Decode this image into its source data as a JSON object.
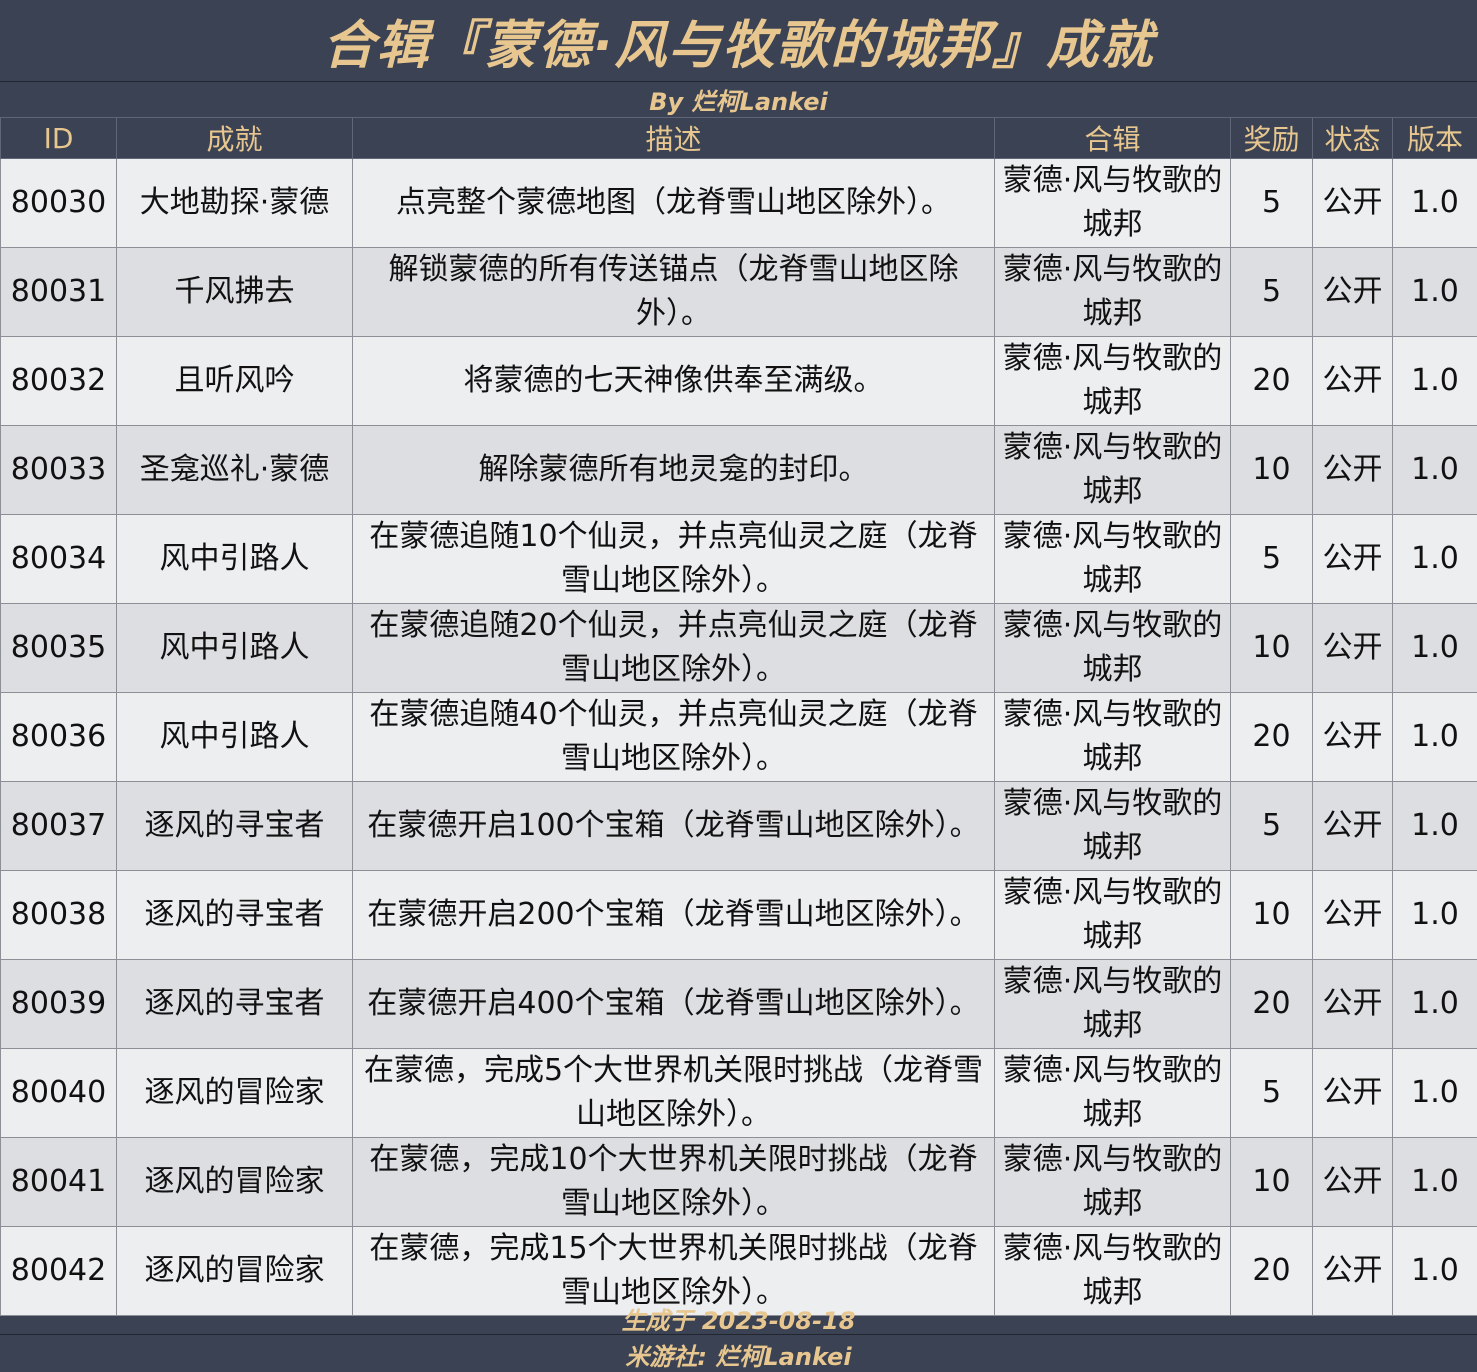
{
  "title": "合辑『蒙德·风与牧歌的城邦』成就",
  "author_line": "By 烂柯Lankei",
  "columns": {
    "id": "ID",
    "name": "成就",
    "desc": "描述",
    "series": "合辑",
    "reward": "奖励",
    "status": "状态",
    "version": "版本"
  },
  "rows": [
    {
      "id": "80030",
      "name": "大地勘探·蒙德",
      "desc": "点亮整个蒙德地图（龙脊雪山地区除外）。",
      "series": "蒙德·风与牧歌的城邦",
      "reward": "5",
      "status": "公开",
      "version": "1.0"
    },
    {
      "id": "80031",
      "name": "千风拂去",
      "desc": "解锁蒙德的所有传送锚点（龙脊雪山地区除外）。",
      "series": "蒙德·风与牧歌的城邦",
      "reward": "5",
      "status": "公开",
      "version": "1.0"
    },
    {
      "id": "80032",
      "name": "且听风吟",
      "desc": "将蒙德的七天神像供奉至满级。",
      "series": "蒙德·风与牧歌的城邦",
      "reward": "20",
      "status": "公开",
      "version": "1.0"
    },
    {
      "id": "80033",
      "name": "圣龛巡礼·蒙德",
      "desc": "解除蒙德所有地灵龛的封印。",
      "series": "蒙德·风与牧歌的城邦",
      "reward": "10",
      "status": "公开",
      "version": "1.0"
    },
    {
      "id": "80034",
      "name": "风中引路人",
      "desc": "在蒙德追随10个仙灵，并点亮仙灵之庭（龙脊雪山地区除外）。",
      "series": "蒙德·风与牧歌的城邦",
      "reward": "5",
      "status": "公开",
      "version": "1.0"
    },
    {
      "id": "80035",
      "name": "风中引路人",
      "desc": "在蒙德追随20个仙灵，并点亮仙灵之庭（龙脊雪山地区除外）。",
      "series": "蒙德·风与牧歌的城邦",
      "reward": "10",
      "status": "公开",
      "version": "1.0"
    },
    {
      "id": "80036",
      "name": "风中引路人",
      "desc": "在蒙德追随40个仙灵，并点亮仙灵之庭（龙脊雪山地区除外）。",
      "series": "蒙德·风与牧歌的城邦",
      "reward": "20",
      "status": "公开",
      "version": "1.0"
    },
    {
      "id": "80037",
      "name": "逐风的寻宝者",
      "desc": "在蒙德开启100个宝箱（龙脊雪山地区除外）。",
      "series": "蒙德·风与牧歌的城邦",
      "reward": "5",
      "status": "公开",
      "version": "1.0"
    },
    {
      "id": "80038",
      "name": "逐风的寻宝者",
      "desc": "在蒙德开启200个宝箱（龙脊雪山地区除外）。",
      "series": "蒙德·风与牧歌的城邦",
      "reward": "10",
      "status": "公开",
      "version": "1.0"
    },
    {
      "id": "80039",
      "name": "逐风的寻宝者",
      "desc": "在蒙德开启400个宝箱（龙脊雪山地区除外）。",
      "series": "蒙德·风与牧歌的城邦",
      "reward": "20",
      "status": "公开",
      "version": "1.0"
    },
    {
      "id": "80040",
      "name": "逐风的冒险家",
      "desc": "在蒙德，完成5个大世界机关限时挑战（龙脊雪山地区除外）。",
      "series": "蒙德·风与牧歌的城邦",
      "reward": "5",
      "status": "公开",
      "version": "1.0"
    },
    {
      "id": "80041",
      "name": "逐风的冒险家",
      "desc": "在蒙德，完成10个大世界机关限时挑战（龙脊雪山地区除外）。",
      "series": "蒙德·风与牧歌的城邦",
      "reward": "10",
      "status": "公开",
      "version": "1.0"
    },
    {
      "id": "80042",
      "name": "逐风的冒险家",
      "desc": "在蒙德，完成15个大世界机关限时挑战（龙脊雪山地区除外）。",
      "series": "蒙德·风与牧歌的城邦",
      "reward": "20",
      "status": "公开",
      "version": "1.0"
    }
  ],
  "footer_date": "生成于 2023-08-18",
  "footer_author": "米游社: 烂柯Lankei",
  "colors": {
    "header_bg": "#3b4253",
    "accent_gold": "#e7c78f",
    "row_light": "#eceeef",
    "row_dark": "#dcdee1"
  }
}
